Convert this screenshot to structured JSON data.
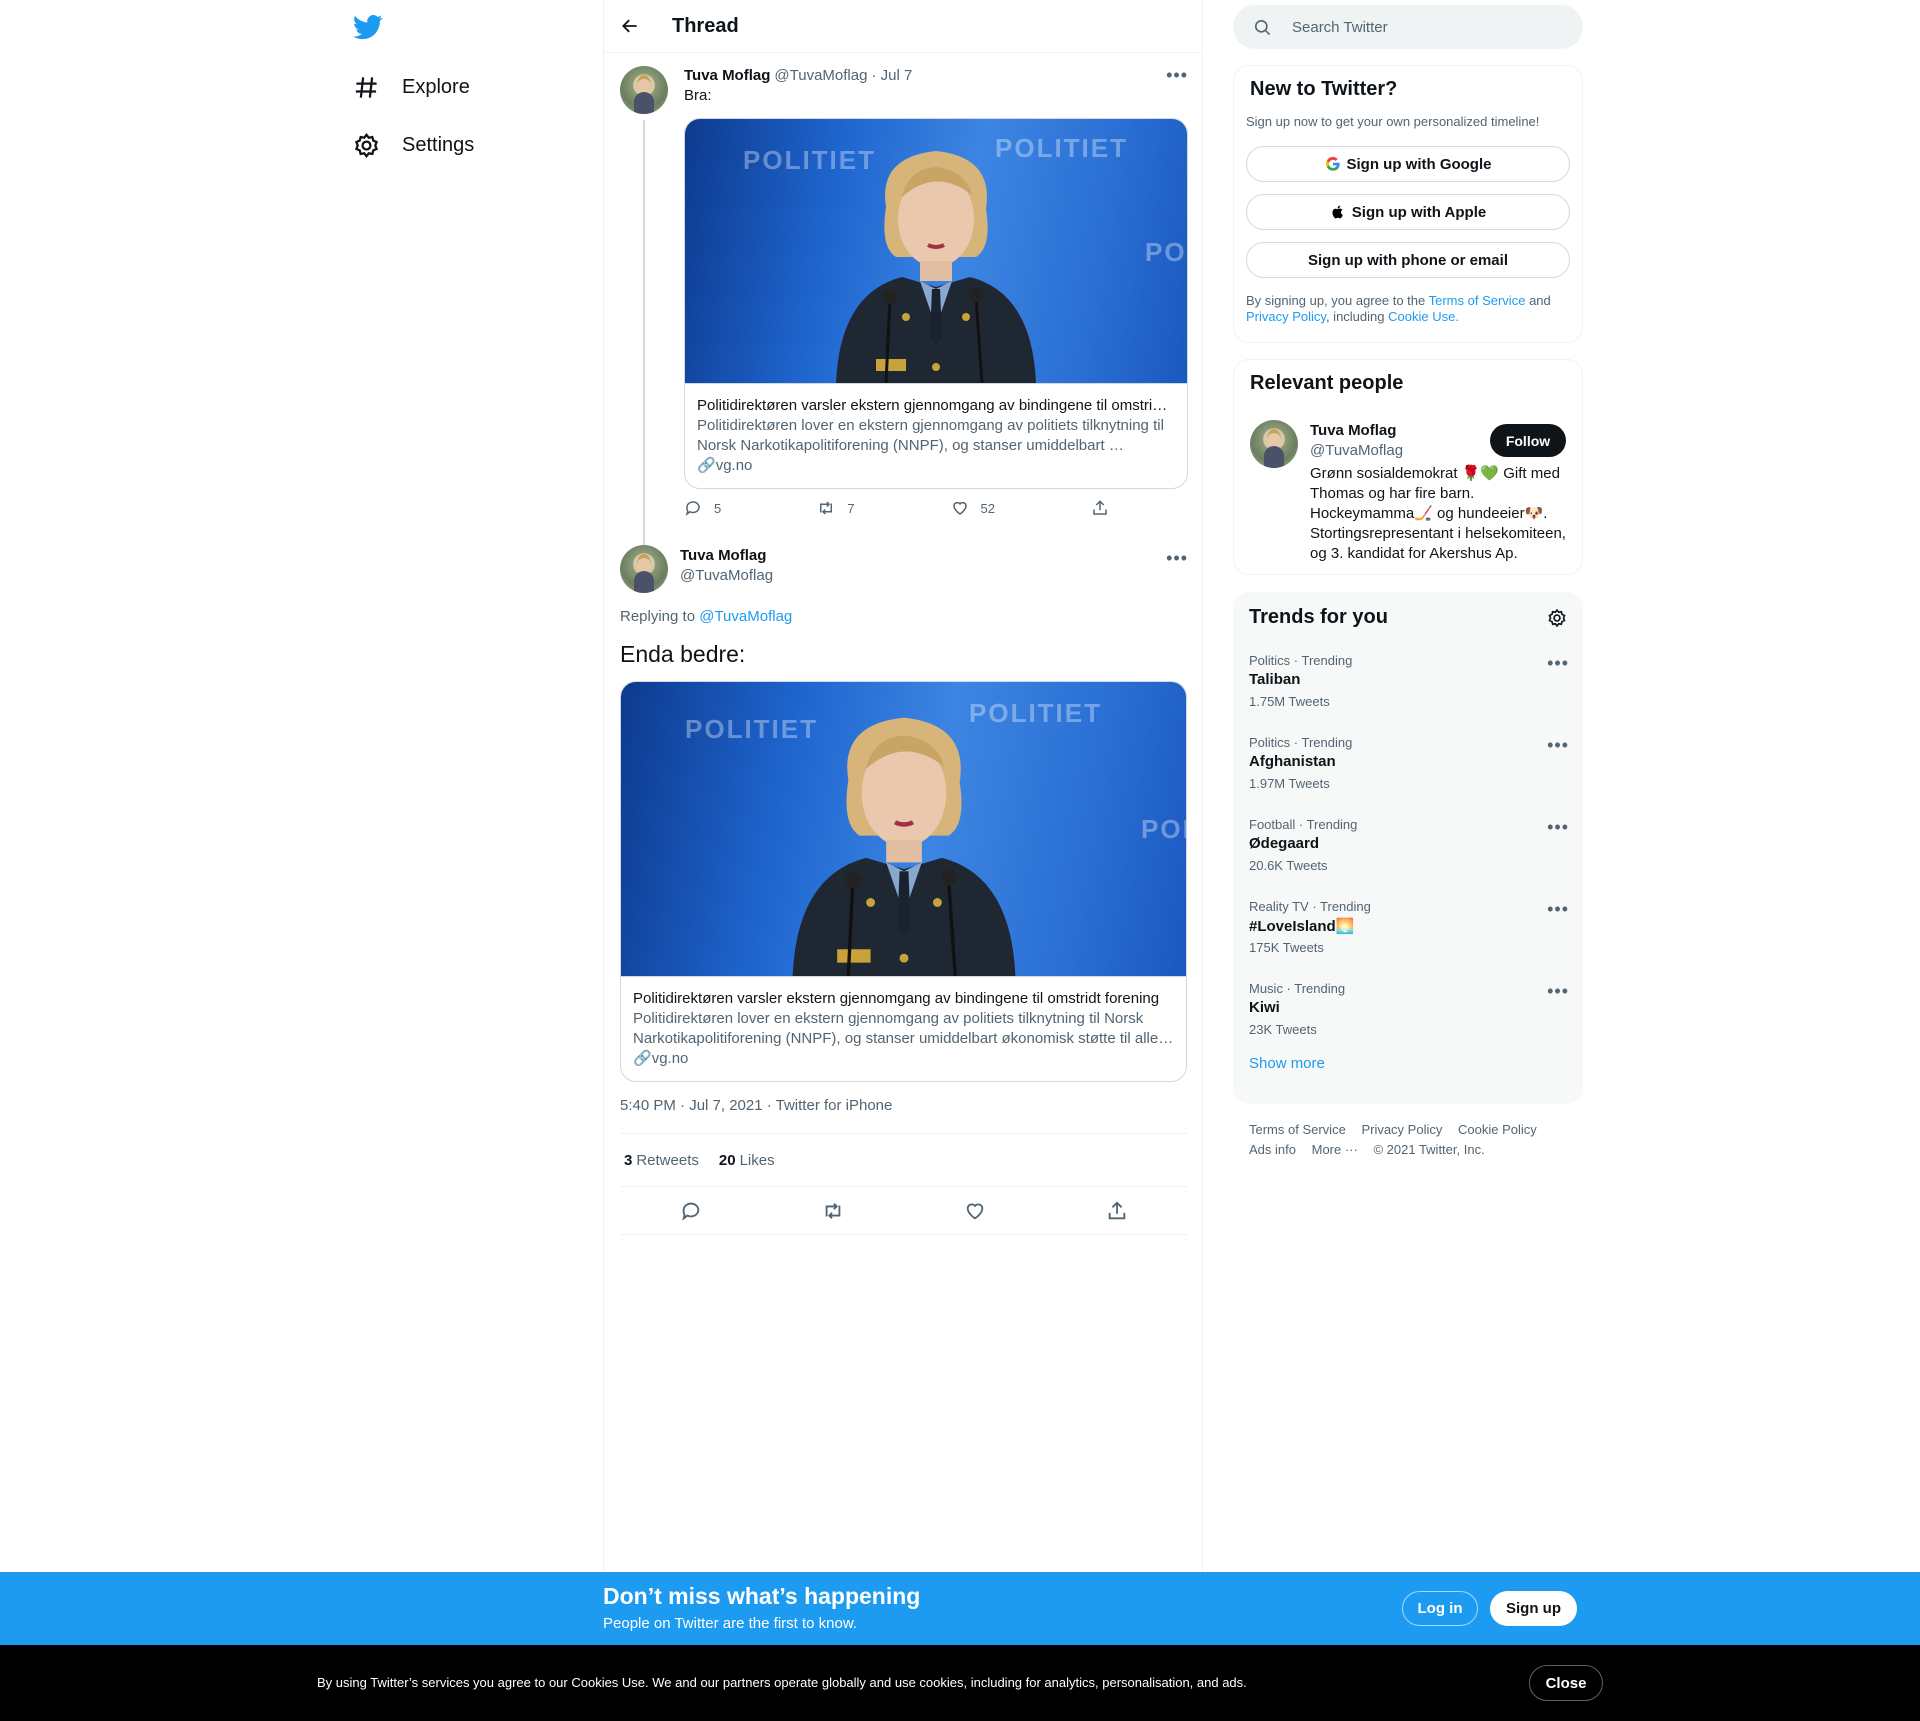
{
  "nav": {
    "items": [
      {
        "label": "Explore",
        "icon": "hash-icon"
      },
      {
        "label": "Settings",
        "icon": "gear-icon"
      }
    ]
  },
  "header": {
    "title": "Thread"
  },
  "tweet1": {
    "name": "Tuva Moflag",
    "handle": "@TuvaMoflag",
    "date": "· Jul 7",
    "text": "Bra:",
    "card": {
      "image_words": [
        "POLITIET",
        "POLITIET",
        "POL"
      ],
      "title": "Politidirektøren varsler ekstern gjennomgang av bindingene til omstridt…",
      "desc": "Politidirektøren lover en ekstern gjennomgang av politiets tilknytning til Norsk Narkotikapolitiforening (NNPF), og stanser umiddelbart …",
      "link": "vg.no"
    },
    "replies": "5",
    "retweets": "7",
    "likes": "52"
  },
  "tweet2": {
    "name": "Tuva Moflag",
    "handle": "@TuvaMoflag",
    "replying_prefix": "Replying to",
    "replying_to": "@TuvaMoflag",
    "text": "Enda bedre:",
    "card": {
      "image_words": [
        "POLITIET",
        "POLITIET",
        "POL"
      ],
      "title": "Politidirektøren varsler ekstern gjennomgang av bindingene til omstridt forening",
      "desc": "Politidirektøren lover en ekstern gjennomgang av politiets tilknytning til Norsk Narkotikapolitiforening (NNPF), og stanser umiddelbart økonomisk støtte til alle…",
      "link": "vg.no"
    },
    "meta": "5:40 PM · Jul 7, 2021 · Twitter for iPhone",
    "retweet_count": "3",
    "retweet_label": "Retweets",
    "like_count": "20",
    "like_label": "Likes"
  },
  "search": {
    "placeholder": "Search Twitter"
  },
  "signup": {
    "title": "New to Twitter?",
    "subtitle": "Sign up now to get your own personalized timeline!",
    "google": "Sign up with Google",
    "apple": "Sign up with Apple",
    "phone": "Sign up with phone or email",
    "legal_1": "By signing up, you agree to the",
    "tos": "Terms of Service",
    "and": "and",
    "privacy": "Privacy Policy",
    "including": ", including",
    "cookie": "Cookie Use."
  },
  "relevant": {
    "title": "Relevant people",
    "name": "Tuva Moflag",
    "handle": "@TuvaMoflag",
    "follow": "Follow",
    "bio": "Grønn sosialdemokrat 🌹💚 Gift med Thomas og har fire barn. Hockeymamma🏒 og hundeeier🐶. Stortingsrepresentant i helsekomiteen, og 3. kandidat for Akershus Ap."
  },
  "trends": {
    "title": "Trends for you",
    "items": [
      {
        "category": "Politics · Trending",
        "name": "Taliban",
        "count": "1.75M Tweets"
      },
      {
        "category": "Politics · Trending",
        "name": "Afghanistan",
        "count": "1.97M Tweets"
      },
      {
        "category": "Football · Trending",
        "name": "Ødegaard",
        "count": "20.6K Tweets"
      },
      {
        "category": "Reality TV · Trending",
        "name": "#LoveIsland🌅",
        "count": "175K Tweets"
      },
      {
        "category": "Music · Trending",
        "name": "Kiwi",
        "count": "23K Tweets"
      }
    ],
    "show_more": "Show more"
  },
  "footer": {
    "tos": "Terms of Service",
    "privacy": "Privacy Policy",
    "cookie": "Cookie Policy",
    "ads": "Ads info",
    "more": "More ···",
    "copyright": "© 2021 Twitter, Inc."
  },
  "banner": {
    "title": "Don’t miss what’s happening",
    "subtitle": "People on Twitter are the first to know.",
    "login": "Log in",
    "signup": "Sign up"
  },
  "cookies": {
    "text": "By using Twitter’s services you agree to our Cookies Use. We and our partners operate globally and use cookies, including for analytics, personalisation, and ads.",
    "close": "Close"
  },
  "colors": {
    "accent": "#1d9bf0",
    "text": "#0f1419",
    "muted": "#536471"
  }
}
